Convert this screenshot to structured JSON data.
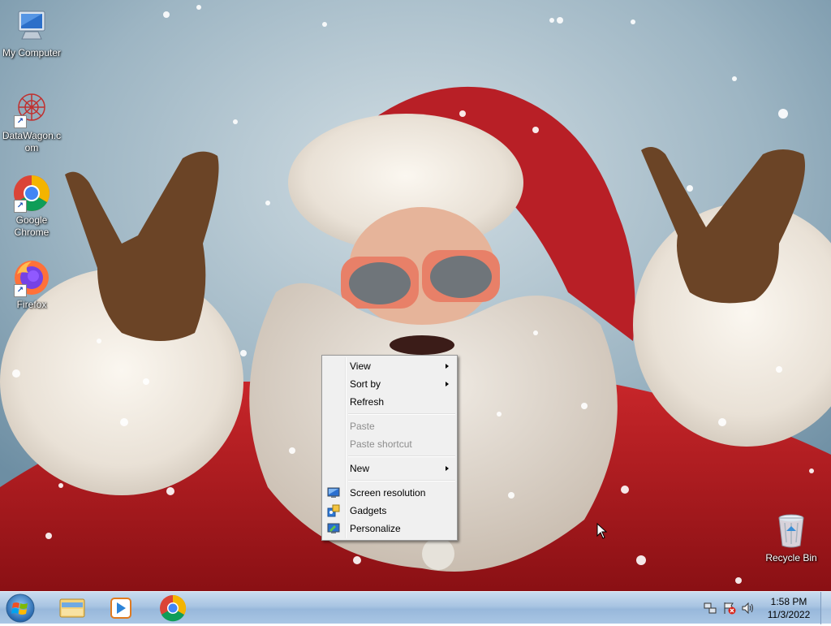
{
  "desktop": {
    "icons": [
      {
        "label": "My Computer",
        "icon": "computer-icon"
      },
      {
        "label": "DataWagon.com",
        "icon": "datawagon-icon"
      },
      {
        "label": "Google Chrome",
        "icon": "chrome-icon"
      },
      {
        "label": "Firefox",
        "icon": "firefox-icon"
      },
      {
        "label": "Recycle Bin",
        "icon": "recycle-bin-icon"
      }
    ]
  },
  "context_menu": {
    "view": "View",
    "sort_by": "Sort by",
    "refresh": "Refresh",
    "paste": "Paste",
    "paste_shortcut": "Paste shortcut",
    "new": "New",
    "screen_resolution": "Screen resolution",
    "gadgets": "Gadgets",
    "personalize": "Personalize"
  },
  "taskbar": {
    "pinned": [
      {
        "icon": "windows-explorer-icon"
      },
      {
        "icon": "media-player-icon"
      },
      {
        "icon": "chrome-icon"
      }
    ],
    "clock": {
      "time": "1:58 PM",
      "date": "11/3/2022"
    },
    "tray": [
      "network-icon",
      "action-center-icon",
      "volume-icon"
    ]
  },
  "colors": {
    "menu_bg": "#f0f0f0",
    "taskbar_top": "#c9dcef",
    "taskbar_bottom": "#98b8db"
  }
}
